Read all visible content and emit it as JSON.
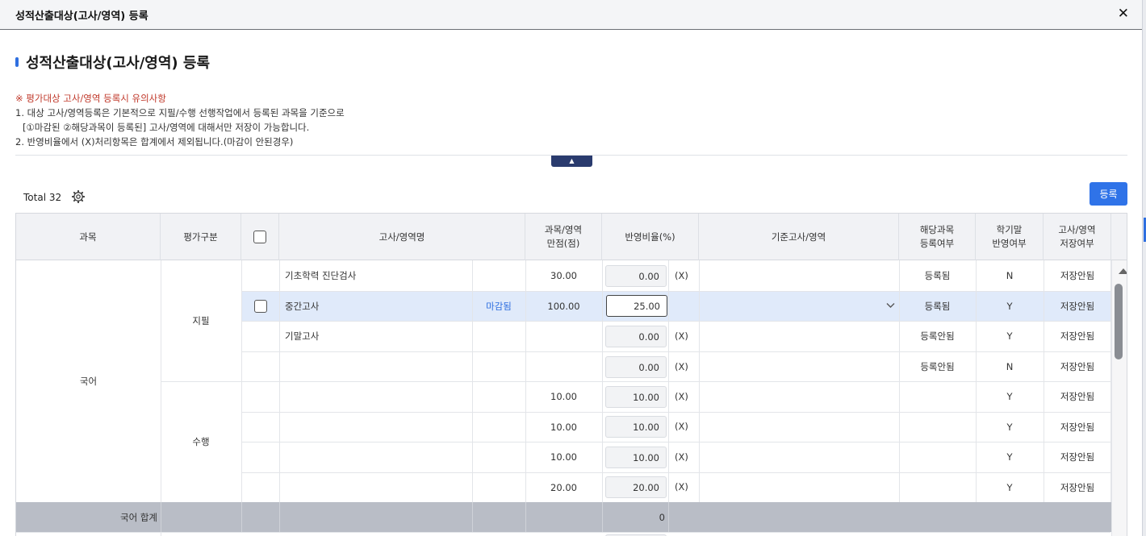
{
  "window": {
    "title": "성적산출대상(고사/영역) 등록",
    "close_label": "✕"
  },
  "page": {
    "title": "성적산출대상(고사/영역) 등록"
  },
  "notice": {
    "heading": "※ 평가대상 고사/영역 등록시 유의사항",
    "line1": "1. 대상 고사/영역등록은 기본적으로 지필/수행 선행작업에서 등록된 과목을 기준으로",
    "line1b": "[①마감된 ②해당과목이 등록된] 고사/영역에 대해서만 저장이 가능합니다.",
    "line2": "2. 반영비율에서 (X)처리항목은 합계에서 제외됩니다.(마감이 안된경우)"
  },
  "collapse_icon": "▲",
  "toolbar": {
    "total_label": "Total 32",
    "register_button": "등록",
    "settings_icon": "gear-icon"
  },
  "table": {
    "headers": {
      "subject": "과목",
      "eval_type": "평가구분",
      "exam_name": "고사/영역명",
      "full_score_1": "과목/영역",
      "full_score_2": "만점(점)",
      "ratio": "반영비율(%)",
      "base_exam": "기준고사/영역",
      "reg_1": "해당과목",
      "reg_2": "등록여부",
      "term_1": "학기말",
      "term_2": "반영여부",
      "save_1": "고사/영역",
      "save_2": "저장여부"
    },
    "group_subject": "국어",
    "group_written": "지필",
    "group_performance": "수행",
    "rows": [
      {
        "exam": "기초학력 진단검사",
        "status": "",
        "score": "30.00",
        "ratio": "0.00",
        "x": "(X)",
        "reg": "등록됨",
        "term": "N",
        "save": "저장안됨"
      },
      {
        "exam": "중간고사",
        "status": "마감됨",
        "score": "100.00",
        "ratio": "25.00",
        "x": "",
        "reg": "등록됨",
        "term": "Y",
        "save": "저장안됨"
      },
      {
        "exam": "기말고사",
        "status": "",
        "score": "",
        "ratio": "0.00",
        "x": "(X)",
        "reg": "등록안됨",
        "term": "Y",
        "save": "저장안됨"
      },
      {
        "exam": "",
        "status": "",
        "score": "",
        "ratio": "0.00",
        "x": "(X)",
        "reg": "등록안됨",
        "term": "N",
        "save": "저장안됨"
      },
      {
        "exam": "",
        "status": "",
        "score": "10.00",
        "ratio": "10.00",
        "x": "(X)",
        "reg": "",
        "term": "Y",
        "save": "저장안됨"
      },
      {
        "exam": "",
        "status": "",
        "score": "10.00",
        "ratio": "10.00",
        "x": "(X)",
        "reg": "",
        "term": "Y",
        "save": "저장안됨"
      },
      {
        "exam": "",
        "status": "",
        "score": "10.00",
        "ratio": "10.00",
        "x": "(X)",
        "reg": "",
        "term": "Y",
        "save": "저장안됨"
      },
      {
        "exam": "",
        "status": "",
        "score": "20.00",
        "ratio": "20.00",
        "x": "(X)",
        "reg": "",
        "term": "Y",
        "save": "저장안됨"
      }
    ],
    "sum_label": "국어 합계",
    "sum_value": "0"
  }
}
